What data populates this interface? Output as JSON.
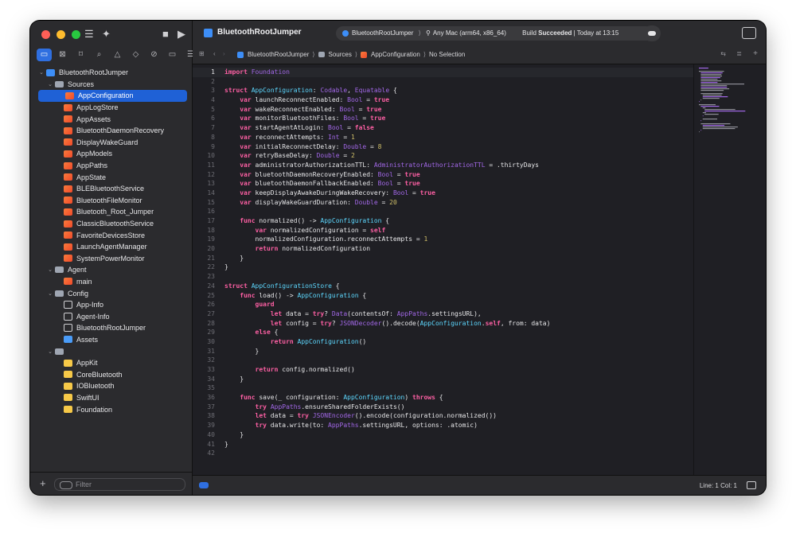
{
  "window": {
    "project_name": "BluetoothRootJumper",
    "scheme": "BluetoothRootJumper",
    "destination": "Any Mac (arm64, x86_64)",
    "build_status_prefix": "Build",
    "build_status_bold": "Succeeded",
    "build_status_suffix": "| Today at 13:15"
  },
  "breadcrumbs": [
    "BluetoothRootJumper",
    "Sources",
    "AppConfiguration",
    "No Selection"
  ],
  "navigator": {
    "tree": [
      {
        "label": "BluetoothRootJumper",
        "type": "proj",
        "depth": 0,
        "chev": "v"
      },
      {
        "label": "Sources",
        "type": "folder",
        "depth": 1,
        "chev": "v"
      },
      {
        "label": "AppConfiguration",
        "type": "swift",
        "depth": 2,
        "selected": true
      },
      {
        "label": "AppLogStore",
        "type": "swift",
        "depth": 2
      },
      {
        "label": "AppAssets",
        "type": "swift",
        "depth": 2
      },
      {
        "label": "BluetoothDaemonRecovery",
        "type": "swift",
        "depth": 2
      },
      {
        "label": "DisplayWakeGuard",
        "type": "swift",
        "depth": 2
      },
      {
        "label": "AppModels",
        "type": "swift",
        "depth": 2
      },
      {
        "label": "AppPaths",
        "type": "swift",
        "depth": 2
      },
      {
        "label": "AppState",
        "type": "swift",
        "depth": 2
      },
      {
        "label": "BLEBluetoothService",
        "type": "swift",
        "depth": 2
      },
      {
        "label": "BluetoothFileMonitor",
        "type": "swift",
        "depth": 2
      },
      {
        "label": "Bluetooth_Root_Jumper",
        "type": "swift",
        "depth": 2
      },
      {
        "label": "ClassicBluetoothService",
        "type": "swift",
        "depth": 2
      },
      {
        "label": "FavoriteDevicesStore",
        "type": "swift",
        "depth": 2
      },
      {
        "label": "LaunchAgentManager",
        "type": "swift",
        "depth": 2
      },
      {
        "label": "SystemPowerMonitor",
        "type": "swift",
        "depth": 2
      },
      {
        "label": "Agent",
        "type": "folder",
        "depth": 1,
        "chev": "v"
      },
      {
        "label": "main",
        "type": "swift",
        "depth": 2
      },
      {
        "label": "Config",
        "type": "folder",
        "depth": 1,
        "chev": "v"
      },
      {
        "label": "App-Info",
        "type": "plist",
        "depth": 2
      },
      {
        "label": "Agent-Info",
        "type": "plist",
        "depth": 2
      },
      {
        "label": "BluetoothRootJumper",
        "type": "plist",
        "depth": 2
      },
      {
        "label": "Assets",
        "type": "assets",
        "depth": 2
      },
      {
        "label": "",
        "type": "folder",
        "depth": 1,
        "chev": "v"
      },
      {
        "label": "AppKit",
        "type": "fw",
        "depth": 2
      },
      {
        "label": "CoreBluetooth",
        "type": "fw",
        "depth": 2
      },
      {
        "label": "IOBluetooth",
        "type": "fw",
        "depth": 2
      },
      {
        "label": "SwiftUI",
        "type": "fw",
        "depth": 2
      },
      {
        "label": "Foundation",
        "type": "fw",
        "depth": 2
      }
    ],
    "filter_placeholder": "Filter"
  },
  "editor": {
    "current_line": 1,
    "lines": [
      "import Foundation",
      "",
      "struct AppConfiguration: Codable, Equatable {",
      "    var launchReconnectEnabled: Bool = true",
      "    var wakeReconnectEnabled: Bool = true",
      "    var monitorBluetoothFiles: Bool = true",
      "    var startAgentAtLogin: Bool = false",
      "    var reconnectAttempts: Int = 1",
      "    var initialReconnectDelay: Double = 8",
      "    var retryBaseDelay: Double = 2",
      "    var administratorAuthorizationTTL: AdministratorAuthorizationTTL = .thirtyDays",
      "    var bluetoothDaemonRecoveryEnabled: Bool = true",
      "    var bluetoothDaemonFallbackEnabled: Bool = true",
      "    var keepDisplayAwakeDuringWakeRecovery: Bool = true",
      "    var displayWakeGuardDuration: Double = 20",
      "",
      "    func normalized() -> AppConfiguration {",
      "        var normalizedConfiguration = self",
      "        normalizedConfiguration.reconnectAttempts = 1",
      "        return normalizedConfiguration",
      "    }",
      "}",
      "",
      "struct AppConfigurationStore {",
      "    func load() -> AppConfiguration {",
      "        guard",
      "            let data = try? Data(contentsOf: AppPaths.settingsURL),",
      "            let config = try? JSONDecoder().decode(AppConfiguration.self, from: data)",
      "        else {",
      "            return AppConfiguration()",
      "        }",
      "",
      "        return config.normalized()",
      "    }",
      "",
      "    func save(_ configuration: AppConfiguration) throws {",
      "        try AppPaths.ensureSharedFolderExists()",
      "        let data = try JSONEncoder().encode(configuration.normalized())",
      "        try data.write(to: AppPaths.settingsURL, options: .atomic)",
      "    }",
      "}",
      ""
    ]
  },
  "statusbar": {
    "line_col": "Line: 1  Col: 1"
  },
  "colors": {
    "keyword": "#fc5fa3",
    "type": "#5dd8ff",
    "property": "#a167e6",
    "number": "#d0bf69",
    "text": "#e6e6e8",
    "accent": "#1f61d6"
  }
}
